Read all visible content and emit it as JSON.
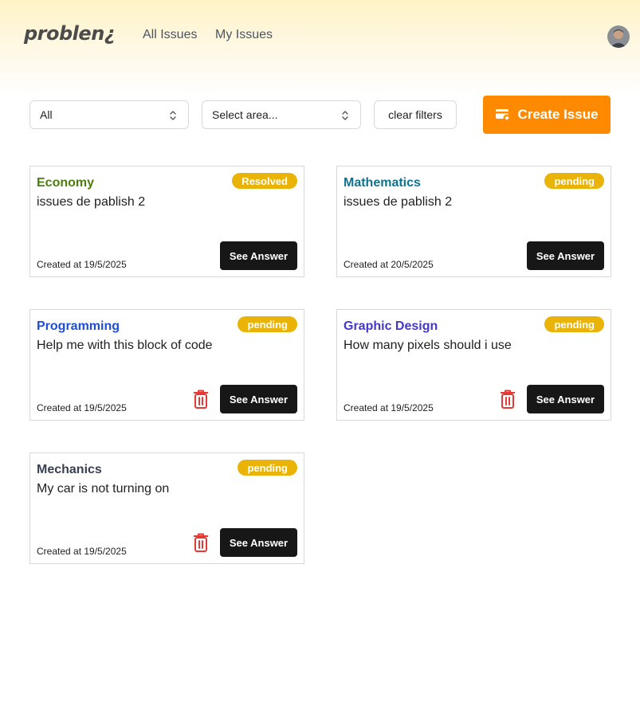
{
  "header": {
    "logo": "problen¿",
    "nav": {
      "all_issues": "All Issues",
      "my_issues": "My Issues"
    },
    "avatar_icon": "user-avatar"
  },
  "filters": {
    "type_value": "All",
    "area_placeholder": "Select area...",
    "clear_label": "clear filters",
    "create_label": "Create Issue",
    "create_icon": "create-issue-icon"
  },
  "colors": {
    "accent": "#ff8a00",
    "badge": "#eab308",
    "button_dark": "#171717",
    "trash": "#e53935"
  },
  "issues": [
    {
      "area": "Economy",
      "area_color": "#4d7c0f",
      "title": "issues de pablish 2",
      "status": "Resolved",
      "created": "Created at 19/5/2025",
      "answer_label": "See Answer",
      "deletable": false
    },
    {
      "area": "Mathematics",
      "area_color": "#0e7490",
      "title": "issues de pablish 2",
      "status": "pending",
      "created": "Created at 20/5/2025",
      "answer_label": "See Answer",
      "deletable": false
    },
    {
      "area": "Programming",
      "area_color": "#1d4ed8",
      "title": "Help me with this block of code",
      "status": "pending",
      "created": "Created at 19/5/2025",
      "answer_label": "See Answer",
      "deletable": true
    },
    {
      "area": "Graphic Design",
      "area_color": "#4338ca",
      "title": "How many pixels should i use",
      "status": "pending",
      "created": "Created at 19/5/2025",
      "answer_label": "See Answer",
      "deletable": true
    },
    {
      "area": "Mechanics",
      "area_color": "#374151",
      "title": "My car is not turning on",
      "status": "pending",
      "created": "Created at 19/5/2025",
      "answer_label": "See Answer",
      "deletable": true
    }
  ]
}
